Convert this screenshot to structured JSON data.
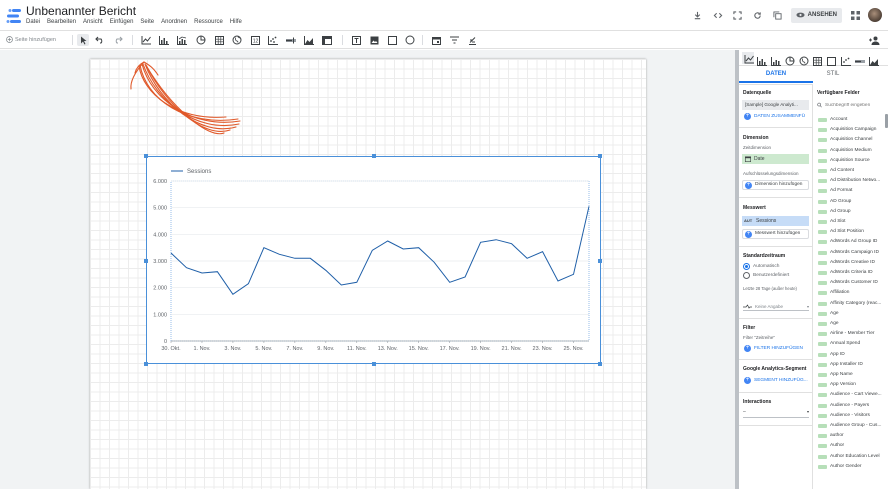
{
  "header": {
    "title": "Unbenannter Bericht",
    "menu": [
      "Datei",
      "Bearbeiten",
      "Ansicht",
      "Einfügen",
      "Seite",
      "Anordnen",
      "Ressource",
      "Hilfe"
    ],
    "view_button": "ANSEHEN"
  },
  "toolbar": {
    "add_page": "Seite hinzufügen",
    "icons": [
      "cursor-icon",
      "undo-icon",
      "redo-icon",
      "time-series-icon",
      "bar-chart-icon",
      "combo-chart-icon",
      "pie-chart-icon",
      "table-icon",
      "geo-map-icon",
      "scorecard-icon",
      "scatter-icon",
      "bullet-icon",
      "area-chart-icon",
      "pivot-icon",
      "text-icon",
      "image-icon",
      "rectangle-icon",
      "circle-icon",
      "date-range-icon",
      "filter-icon",
      "data-control-icon"
    ]
  },
  "chart_data": {
    "type": "line",
    "series": [
      {
        "name": "Sessions",
        "values": [
          3300,
          2750,
          2550,
          2600,
          1750,
          2150,
          3500,
          3250,
          3100,
          3100,
          2650,
          2100,
          2200,
          3400,
          3750,
          3450,
          3500,
          2950,
          2200,
          2400,
          3700,
          3800,
          3650,
          3100,
          3350,
          2250,
          2500,
          5050
        ]
      }
    ],
    "x_tick_labels": [
      "30. Okt.",
      "1. Nov.",
      "3. Nov.",
      "5. Nov.",
      "7. Nov.",
      "9. Nov.",
      "11. Nov.",
      "13. Nov.",
      "15. Nov.",
      "17. Nov.",
      "19. Nov.",
      "21. Nov.",
      "23. Nov.",
      "25. Nov."
    ],
    "y_tick_labels": [
      "0",
      "1.000",
      "2.000",
      "3.000",
      "4.000",
      "5.000",
      "6.000"
    ],
    "ylim": [
      0,
      6000
    ],
    "grid": true,
    "legend": "top-left",
    "color": "#1f5fa8"
  },
  "tabs": {
    "data": "DATEN",
    "style": "STIL"
  },
  "data_panel": {
    "datasource_title": "Datenquelle",
    "datasource_value": "[Sample] Google Analyti...",
    "blend_label": "DATEN ZUSAMMENFÜ",
    "dimension_title": "Dimension",
    "time_dimension_label": "Zeitdimension",
    "time_dimension_value": "Date",
    "breakdown_label": "Aufschlüsselungsdimension",
    "add_dimension": "Dimension hinzufügen",
    "metric_title": "Messwert",
    "metric_type": "AUT",
    "metric_value": "Sessions",
    "add_metric": "Messwert hinzufügen",
    "date_range_title": "Standardzeitraum",
    "date_auto": "Automatisch",
    "date_custom": "Benutzerdefiniert",
    "date_hint": "Letzte 28 Tage (außer heute)",
    "comparison_value": "Keine Angabe",
    "filter_title": "Filter",
    "filter_label": "Filter \"Zeitreihe\"",
    "add_filter": "FILTER HINZUFÜGEN",
    "segment_title": "Google Analytics-Segment",
    "add_segment": "SEGMENT HINZUFÜG...",
    "interactions_title": "Interactions",
    "interactions_value": "–"
  },
  "fields_panel": {
    "title": "Verfügbare Felder",
    "search_placeholder": "Suchbegriff eingeben",
    "fields": [
      "Account",
      "Acquisition Campaign",
      "Acquisition Channel",
      "Acquisition Medium",
      "Acquisition Source",
      "Ad Content",
      "Ad Distribution Netwo...",
      "Ad Format",
      "AD Group",
      "Ad Group",
      "Ad Slot",
      "Ad Slot Position",
      "AdWords Ad Group ID",
      "AdWords Campaign ID",
      "AdWords Creative ID",
      "AdWords Criteria ID",
      "AdWords Customer ID",
      "Affiliation",
      "Affinity Category (reac...",
      "Age",
      "Age",
      "Airline - Member Tier",
      "Annual Spend",
      "App ID",
      "App Installer ID",
      "App Name",
      "App Version",
      "Audience - Cart Viewe...",
      "Audience - Payers",
      "Audience - Visitors",
      "Audience Group - Cus...",
      "author",
      "Author",
      "Author Education Level",
      "Author Gender"
    ]
  }
}
